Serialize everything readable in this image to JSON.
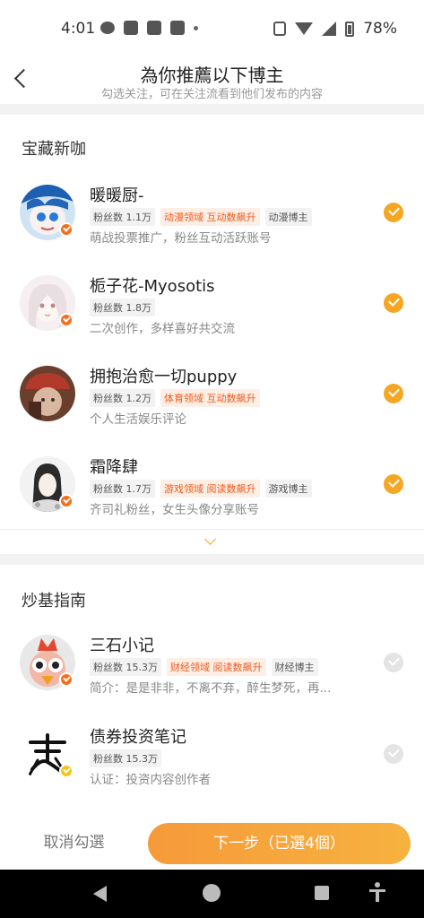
{
  "status_bar": {
    "time": "4:01",
    "battery": "78%"
  },
  "header": {
    "title": "為你推薦以下博主",
    "subtitle": "勾选关注，可在关注流看到他们发布的内容"
  },
  "sections": [
    {
      "title": "宝藏新咖",
      "items": [
        {
          "name": "暖暖厨-",
          "fans": "粉丝数 1.1万",
          "hot_tag": "动漫领域 互动数飙升",
          "tag": "动漫博主",
          "desc": "萌战投票推广，粉丝互动活跃账号",
          "checked": true
        },
        {
          "name": "栀子花-Myosotis",
          "fans": "粉丝数 1.8万",
          "hot_tag": "",
          "tag": "",
          "desc": "二次创作，多样喜好共交流",
          "checked": true
        },
        {
          "name": "拥抱治愈一切puppy",
          "fans": "粉丝数 1.2万",
          "hot_tag": "体育领域 互动数飙升",
          "tag": "",
          "desc": "个人生活娱乐评论",
          "checked": true
        },
        {
          "name": "霜降肆",
          "fans": "粉丝数 1.7万",
          "hot_tag": "游戏领域 阅读数飙升",
          "tag": "游戏博主",
          "desc": "齐司礼粉丝，女生头像分享账号",
          "checked": true
        }
      ]
    },
    {
      "title": "炒基指南",
      "items": [
        {
          "name": "三石小记",
          "fans": "粉丝数 15.3万",
          "hot_tag": "财经领域 阅读数飙升",
          "tag": "财经博主",
          "desc": "简介：是是非非，不离不弃，醉生梦死，再...",
          "checked": false
        },
        {
          "name": "债券投资笔记",
          "fans": "粉丝数 15.3万",
          "hot_tag": "",
          "tag": "",
          "desc": "认证：投资内容创作者",
          "checked": false
        }
      ]
    }
  ],
  "bottom": {
    "cancel_label": "取消勾選",
    "next_label": "下一步（已選4個）"
  },
  "colors": {
    "accent": "#f5a623",
    "hot_tag_text": "#f05a1a",
    "badge_orange": "#f07020",
    "badge_yellow": "#f5c518"
  }
}
